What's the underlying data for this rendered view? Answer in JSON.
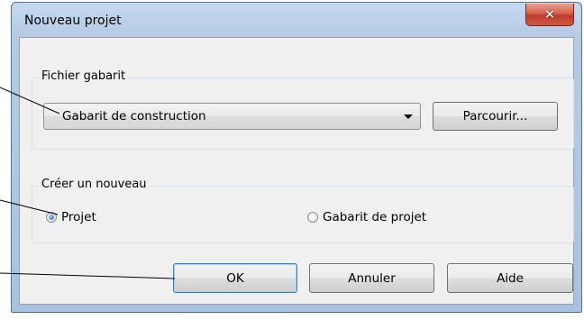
{
  "window": {
    "title": "Nouveau projet",
    "close_icon": "close-icon"
  },
  "template_group": {
    "legend": "Fichier gabarit",
    "selected_template": "Gabarit de construction",
    "browse_label": "Parcourir..."
  },
  "create_group": {
    "legend": "Créer un nouveau",
    "options": [
      {
        "label": "Projet",
        "checked": true
      },
      {
        "label": "Gabarit de projet",
        "checked": false
      }
    ]
  },
  "buttons": {
    "ok_label": "OK",
    "cancel_label": "Annuler",
    "help_label": "Aide"
  }
}
